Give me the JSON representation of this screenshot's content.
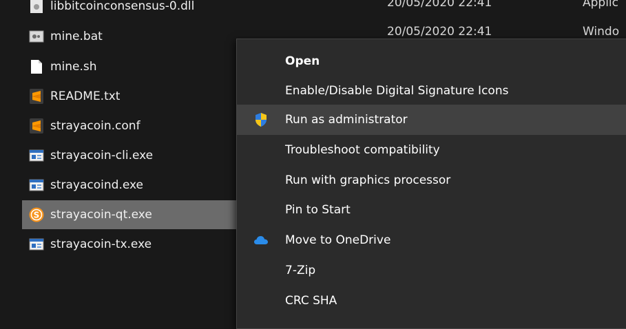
{
  "explorer": {
    "partial_row": {
      "name": "libbitcoinconsensus-0.dll",
      "date": "20/05/2020 22:41",
      "type": "Applic"
    },
    "second_row_meta": {
      "date": "20/05/2020 22:41",
      "type": "Windo"
    },
    "files": [
      {
        "name": "mine.bat",
        "icon": "batch-file-icon"
      },
      {
        "name": "mine.sh",
        "icon": "blank-file-icon"
      },
      {
        "name": "README.txt",
        "icon": "sublime-text-icon"
      },
      {
        "name": "strayacoin.conf",
        "icon": "sublime-text-icon"
      },
      {
        "name": "strayacoin-cli.exe",
        "icon": "exe-window-icon"
      },
      {
        "name": "strayacoind.exe",
        "icon": "exe-window-icon"
      },
      {
        "name": "strayacoin-qt.exe",
        "icon": "strayacoin-logo-icon",
        "selected": true
      },
      {
        "name": "strayacoin-tx.exe",
        "icon": "exe-window-icon"
      }
    ]
  },
  "context_menu": {
    "items": [
      {
        "label": "Open",
        "bold": true
      },
      {
        "label": "Enable/Disable Digital Signature Icons"
      },
      {
        "label": "Run as administrator",
        "icon": "uac-shield-icon",
        "highlighted": true
      },
      {
        "label": "Troubleshoot compatibility"
      },
      {
        "label": "Run with graphics processor"
      },
      {
        "label": "Pin to Start"
      },
      {
        "label": "Move to OneDrive",
        "icon": "onedrive-cloud-icon"
      },
      {
        "label": "7-Zip"
      },
      {
        "label": "CRC SHA"
      }
    ]
  }
}
